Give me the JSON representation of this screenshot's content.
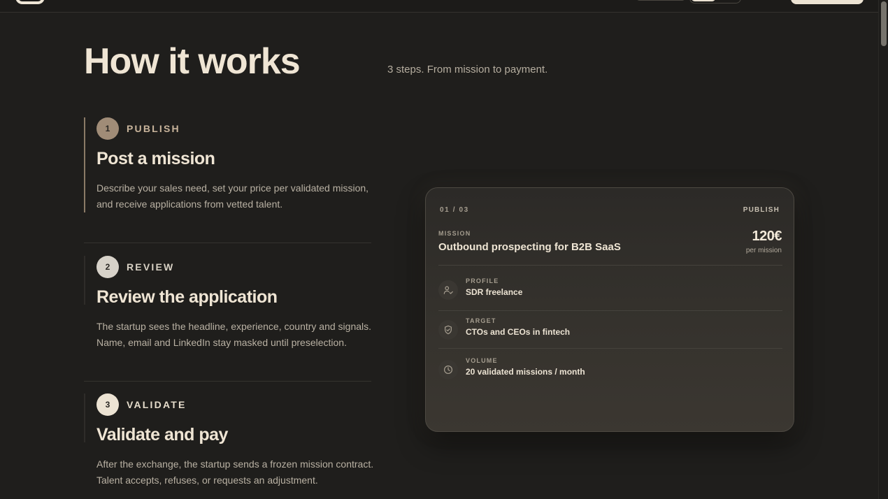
{
  "header": {
    "title": "How it works",
    "subtitle": "3 steps. From mission to payment."
  },
  "steps": [
    {
      "number": "1",
      "label": "PUBLISH",
      "title": "Post a mission",
      "description": "Describe your sales need, set your price per validated mission, and receive applications from vetted talent."
    },
    {
      "number": "2",
      "label": "REVIEW",
      "title": "Review the application",
      "description": "The startup sees the headline, experience, country and signals. Name, email and LinkedIn stay masked until preselection."
    },
    {
      "number": "3",
      "label": "VALIDATE",
      "title": "Validate and pay",
      "description": "After the exchange, the startup sends a frozen mission contract. Talent accepts, refuses, or requests an adjustment."
    }
  ],
  "card": {
    "counter": "01 / 03",
    "stage": "PUBLISH",
    "mission_kicker": "MISSION",
    "mission_title": "Outbound prospecting for B2B SaaS",
    "price": "120€",
    "price_unit": "per mission",
    "rows": [
      {
        "icon": "user-check-icon",
        "label": "PROFILE",
        "value": "SDR freelance"
      },
      {
        "icon": "shield-check-icon",
        "label": "TARGET",
        "value": "CTOs and CEOs in fintech"
      },
      {
        "icon": "clock-icon",
        "label": "VOLUME",
        "value": "20 validated missions / month"
      }
    ]
  },
  "colors": {
    "background": "#1f1e1c",
    "text_primary": "#efe5d4",
    "text_muted": "#b9b1a3",
    "accent_step1": "#a08c77",
    "card_border": "#4d4942"
  }
}
